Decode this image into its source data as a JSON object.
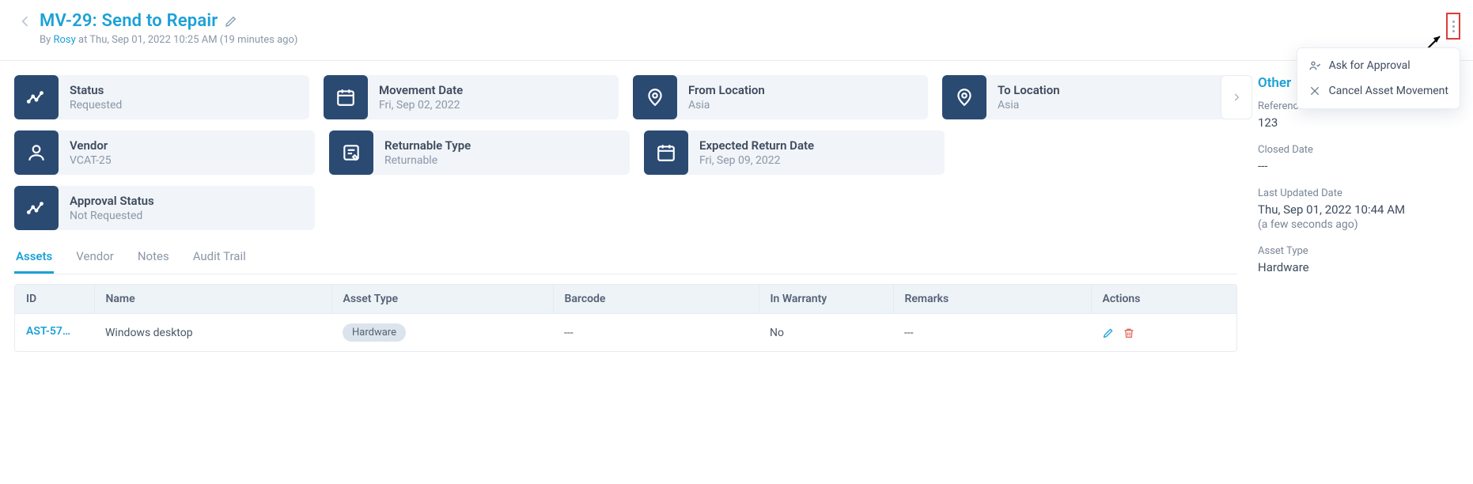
{
  "header": {
    "title": "MV-29: Send to Repair",
    "by_prefix": "By ",
    "user": "Rosy",
    "byline_rest": " at Thu, Sep 01, 2022 10:25 AM (19 minutes ago)"
  },
  "tiles": {
    "status": {
      "label": "Status",
      "value": "Requested"
    },
    "movement_date": {
      "label": "Movement Date",
      "value": "Fri, Sep 02, 2022"
    },
    "from_location": {
      "label": "From Location",
      "value": "Asia"
    },
    "to_location": {
      "label": "To Location",
      "value": "Asia"
    },
    "vendor": {
      "label": "Vendor",
      "value": "VCAT-25"
    },
    "returnable_type": {
      "label": "Returnable Type",
      "value": "Returnable"
    },
    "expected_return_date": {
      "label": "Expected Return Date",
      "value": "Fri, Sep 09, 2022"
    },
    "approval_status": {
      "label": "Approval Status",
      "value": "Not Requested"
    }
  },
  "tabs": {
    "assets": "Assets",
    "vendor": "Vendor",
    "notes": "Notes",
    "audit": "Audit Trail"
  },
  "table": {
    "headers": {
      "id": "ID",
      "name": "Name",
      "asset_type": "Asset Type",
      "barcode": "Barcode",
      "warranty": "In Warranty",
      "remarks": "Remarks",
      "actions": "Actions"
    },
    "rows": [
      {
        "id": "AST-57…",
        "name": "Windows desktop",
        "asset_type": "Hardware",
        "barcode": "---",
        "warranty": "No",
        "remarks": "---"
      }
    ]
  },
  "side": {
    "title": "Other",
    "reference_number": {
      "label": "Reference Number",
      "value": "123"
    },
    "closed_date": {
      "label": "Closed Date",
      "value": "---"
    },
    "last_updated": {
      "label": "Last Updated Date",
      "value": "Thu, Sep 01, 2022 10:44 AM",
      "ago": "(a few seconds ago)"
    },
    "asset_type": {
      "label": "Asset Type",
      "value": "Hardware"
    }
  },
  "menu": {
    "ask_approval": "Ask for Approval",
    "cancel_movement": "Cancel Asset Movement"
  }
}
